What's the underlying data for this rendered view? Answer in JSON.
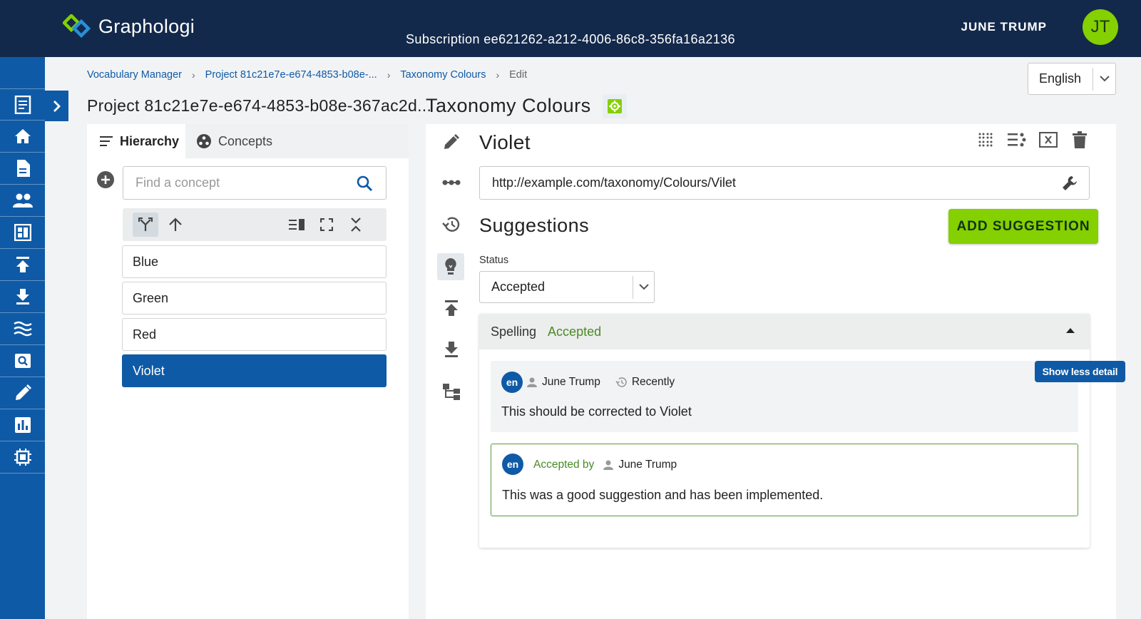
{
  "app": {
    "name": "Graphologi",
    "subscription": "Subscription ee621262-a212-4006-86c8-356fa16a2136"
  },
  "user": {
    "name": "JUNE TRUMP",
    "initials": "JT"
  },
  "colors": {
    "topbar": "#13294b",
    "sidebar": "#0f5aa6",
    "accent": "#84d000",
    "accepted": "#4a8a25"
  },
  "sidebar": {
    "items": [
      {
        "icon": "document-icon"
      },
      {
        "icon": "home-icon"
      },
      {
        "icon": "file-icon"
      },
      {
        "icon": "people-icon"
      },
      {
        "icon": "dashboard-icon"
      },
      {
        "icon": "upload-icon"
      },
      {
        "icon": "download-icon"
      },
      {
        "icon": "waves-icon"
      },
      {
        "icon": "search-doc-icon"
      },
      {
        "icon": "pencil-icon"
      },
      {
        "icon": "chart-icon"
      },
      {
        "icon": "chip-icon"
      }
    ]
  },
  "breadcrumb": {
    "items": [
      "Vocabulary Manager",
      "Project 81c21e7e-e674-4853-b08e-...",
      "Taxonomy Colours"
    ],
    "current": "Edit"
  },
  "language": {
    "selected": "English"
  },
  "project": {
    "title": "Project 81c21e7e-e674-4853-b08e-367ac2d..."
  },
  "taxonomy": {
    "title": "Taxonomy Colours"
  },
  "left": {
    "tabs": [
      {
        "label": "Hierarchy",
        "icon": "list-icon"
      },
      {
        "label": "Concepts",
        "icon": "concepts-icon"
      }
    ],
    "search": {
      "placeholder": "Find a concept",
      "value": ""
    },
    "concepts": [
      "Blue",
      "Green",
      "Red",
      "Violet"
    ],
    "selected": "Violet"
  },
  "concept": {
    "name": "Violet",
    "uri": "http://example.com/taxonomy/Colours/Vilet"
  },
  "suggestions": {
    "heading": "Suggestions",
    "add_button": "ADD SUGGESTION",
    "status_label": "Status",
    "status_value": "Accepted",
    "card": {
      "type": "Spelling",
      "status": "Accepted",
      "comment": {
        "lang": "en",
        "author": "June Trump",
        "time": "Recently",
        "text": "This should be corrected to Violet"
      },
      "response": {
        "lang": "en",
        "label": "Accepted by",
        "author": "June Trump",
        "text": "This was a good suggestion and has been implemented."
      }
    },
    "tooltip": "Show less detail"
  }
}
